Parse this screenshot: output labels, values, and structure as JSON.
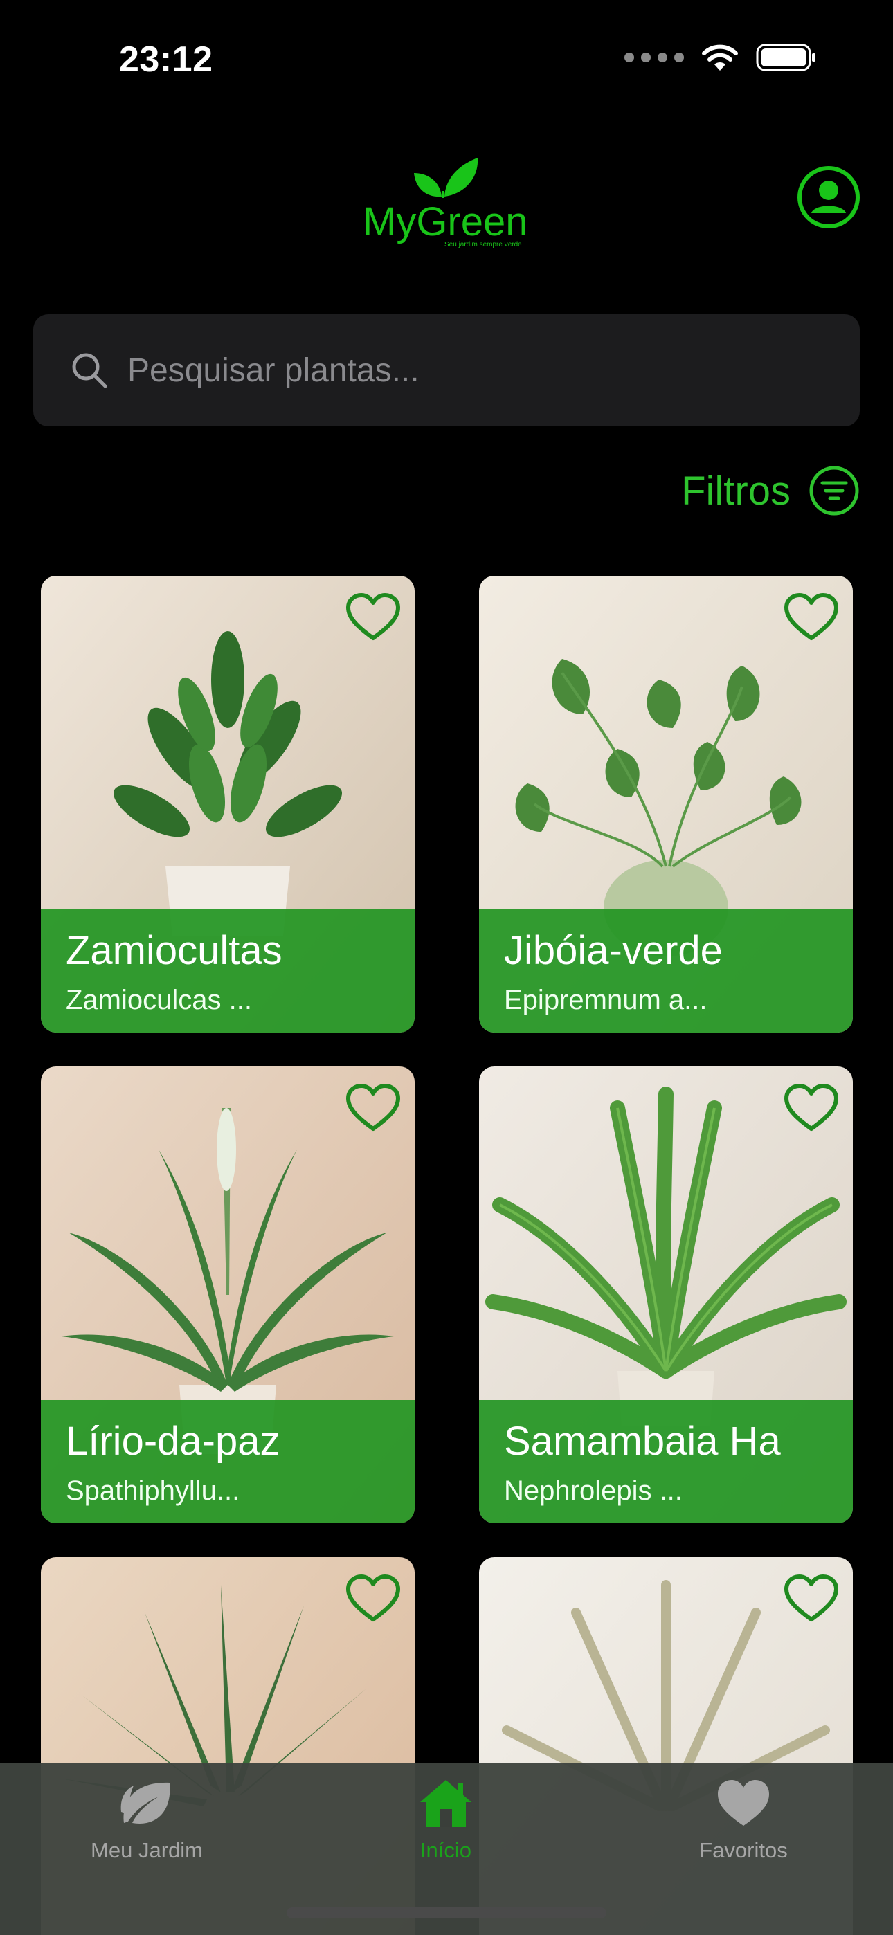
{
  "status_bar": {
    "time": "23:12"
  },
  "header": {
    "logo_text": "MyGreen",
    "logo_tagline": "Seu jardim sempre verde",
    "profile_icon": "person-circle-icon"
  },
  "search": {
    "placeholder": "Pesquisar plantas...",
    "value": ""
  },
  "filters": {
    "label": "Filtros"
  },
  "plants": [
    {
      "name": "Zamiocultas",
      "scientific": "Zamioculcas ..."
    },
    {
      "name": "Jibóia-verde",
      "scientific": "Epipremnum a..."
    },
    {
      "name": "Lírio-da-paz",
      "scientific": "Spathiphyllu..."
    },
    {
      "name": "Samambaia Ha",
      "scientific": "Nephrolepis ..."
    },
    {
      "name": "",
      "scientific": ""
    },
    {
      "name": "",
      "scientific": ""
    }
  ],
  "tabbar": {
    "tabs": [
      {
        "label": "Meu Jardim",
        "icon": "leaf-icon"
      },
      {
        "label": "Início",
        "icon": "home-icon",
        "active": true
      },
      {
        "label": "Favoritos",
        "icon": "heart-icon"
      }
    ]
  },
  "colors": {
    "accent": "#2ec42e",
    "card_band": "#239623",
    "background": "#000000",
    "search_bg": "#1c1c1e"
  }
}
